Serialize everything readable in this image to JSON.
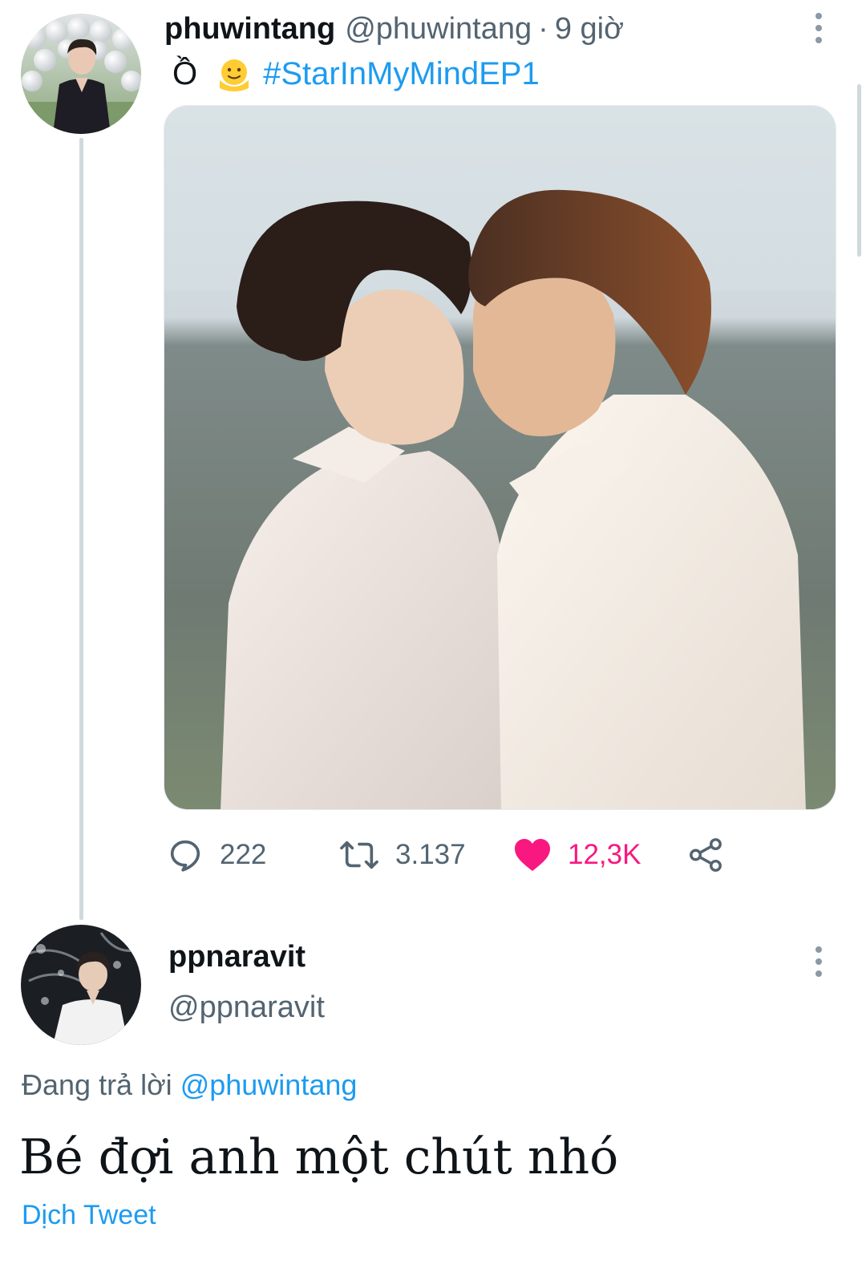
{
  "tweet": {
    "author_name": "phuwintang",
    "author_handle": "@phuwintang",
    "separator": "·",
    "time": "9 giờ",
    "text_prefix": "Ồ",
    "emoji_icon": "smiling-face-emoji",
    "hashtag": "#StarInMyMindEP1",
    "media_icon": "photo-two-men-white-shirts",
    "replies": "222",
    "retweets": "3.137",
    "likes": "12,3K",
    "liked": true
  },
  "reply": {
    "author_name": "ppnaravit",
    "author_handle": "@ppnaravit",
    "replying_prefix": "Đang trả lời",
    "replying_mention": "@phuwintang",
    "text": "Bé đợi anh một chút nhó",
    "translate_label": "Dịch Tweet"
  },
  "colors": {
    "link": "#1d9bf0",
    "like": "#f91880",
    "secondary_text": "#536471",
    "thread_line": "#cfd9de"
  }
}
